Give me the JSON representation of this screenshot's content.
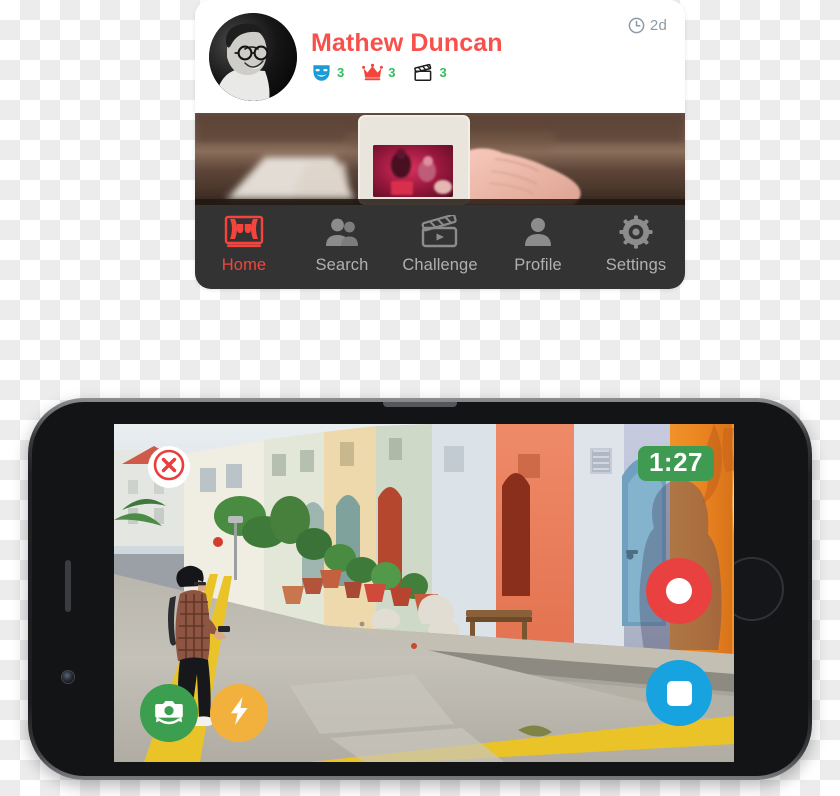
{
  "profile_card": {
    "avatar_alt": "avatar-portrait",
    "user_name": "Mathew Duncan",
    "time_ago": "2d",
    "clock_icon": "clock-icon",
    "stats": [
      {
        "icon": "theater-mask-icon",
        "value": "3",
        "color": "#1b9ad6"
      },
      {
        "icon": "crown-icon",
        "value": "3",
        "color": "#f4443c"
      },
      {
        "icon": "clapperboard-icon",
        "value": "3",
        "color": "#1d1d1d"
      }
    ],
    "stat_value_color": "#2fbf5c",
    "name_color": "#f8504a",
    "time_color": "#8d9aa6",
    "banner_alt": "hand-holding-photo-slide-banner"
  },
  "nav_bar": {
    "background": "#333333",
    "active_color": "#f4443c",
    "inactive_color": "#b0b0b0",
    "items": [
      {
        "icon": "theater-stage-icon",
        "label": "Home",
        "active": true
      },
      {
        "icon": "people-icon",
        "label": "Search",
        "active": false
      },
      {
        "icon": "clapperboard-play-icon",
        "label": "Challenge",
        "active": false
      },
      {
        "icon": "person-icon",
        "label": "Profile",
        "active": false
      },
      {
        "icon": "gear-icon",
        "label": "Settings",
        "active": false
      }
    ]
  },
  "phone": {
    "device_alt": "smartphone-landscape-mockup",
    "screen_alt": "street-alley-camera-viewfinder",
    "overlays": {
      "close_icon": "close-x-icon",
      "timer": "1:27",
      "timer_color": "#3f9b52",
      "record_icon": "record-circle-icon",
      "record_color": "#e8413f",
      "stop_icon": "stop-square-icon",
      "stop_color": "#17a3e0",
      "flip_camera_icon": "camera-flip-icon",
      "flip_color": "#3c9e4f",
      "flash_icon": "flash-bolt-icon",
      "flash_color": "#f2b13c"
    }
  }
}
